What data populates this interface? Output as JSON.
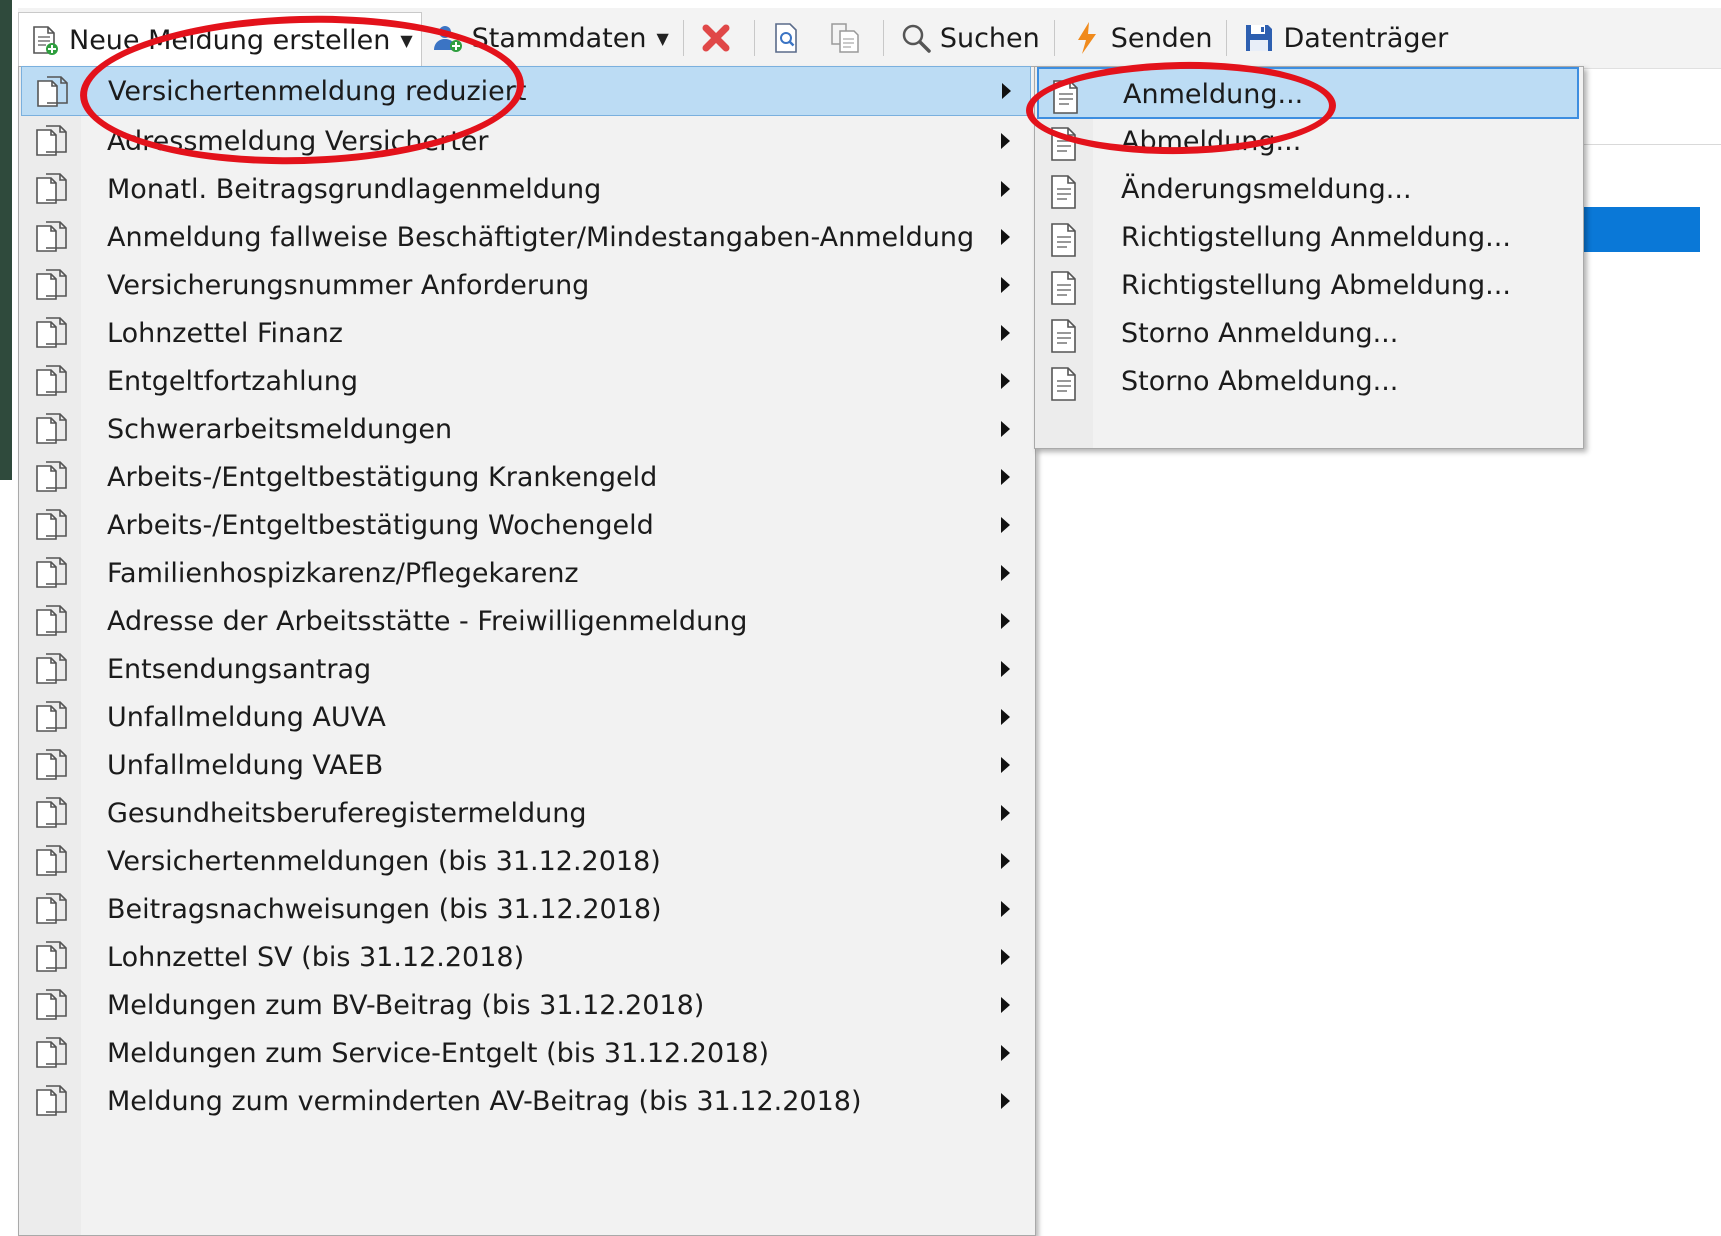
{
  "toolbar": {
    "new_report_label": "Neue Meldung erstellen",
    "master_data_label": "Stammdaten",
    "search_label": "Suchen",
    "send_label": "Senden",
    "data_carrier_label": "Datenträger"
  },
  "menu": {
    "items": [
      {
        "label": "Versichertenmeldung reduziert"
      },
      {
        "label": "Adressmeldung Versicherter"
      },
      {
        "label": "Monatl. Beitragsgrundlagenmeldung"
      },
      {
        "label": "Anmeldung fallweise Beschäftigter/Mindestangaben-Anmeldung"
      },
      {
        "label": "Versicherungsnummer Anforderung"
      },
      {
        "label": "Lohnzettel Finanz"
      },
      {
        "label": "Entgeltfortzahlung"
      },
      {
        "label": "Schwerarbeitsmeldungen"
      },
      {
        "label": "Arbeits-/Entgeltbestätigung Krankengeld"
      },
      {
        "label": "Arbeits-/Entgeltbestätigung Wochengeld"
      },
      {
        "label": "Familienhospizkarenz/Pflegekarenz"
      },
      {
        "label": "Adresse der Arbeitsstätte - Freiwilligenmeldung"
      },
      {
        "label": "Entsendungsantrag"
      },
      {
        "label": "Unfallmeldung AUVA"
      },
      {
        "label": "Unfallmeldung VAEB"
      },
      {
        "label": "Gesundheitsberuferegistermeldung"
      },
      {
        "label": "Versichertenmeldungen (bis 31.12.2018)"
      },
      {
        "label": "Beitragsnachweisungen (bis 31.12.2018)"
      },
      {
        "label": "Lohnzettel SV (bis 31.12.2018)"
      },
      {
        "label": "Meldungen zum BV-Beitrag (bis 31.12.2018)"
      },
      {
        "label": "Meldungen zum Service-Entgelt (bis 31.12.2018)"
      },
      {
        "label": "Meldung zum verminderten AV-Beitrag (bis 31.12.2018)"
      }
    ]
  },
  "submenu": {
    "items": [
      {
        "label": "Anmeldung..."
      },
      {
        "label": "Abmeldung..."
      },
      {
        "label": "Änderungsmeldung..."
      },
      {
        "label": "Richtigstellung Anmeldung..."
      },
      {
        "label": "Richtigstellung Abmeldung..."
      },
      {
        "label": "Storno Anmeldung..."
      },
      {
        "label": "Storno Abmeldung..."
      }
    ]
  },
  "colors": {
    "highlight": "#bcdcf4",
    "annotation": "#e3121b",
    "accent_blue": "#0a78d7"
  },
  "icons": {
    "menu_item": "copy-document-icon",
    "submenu_item": "document-icon"
  }
}
